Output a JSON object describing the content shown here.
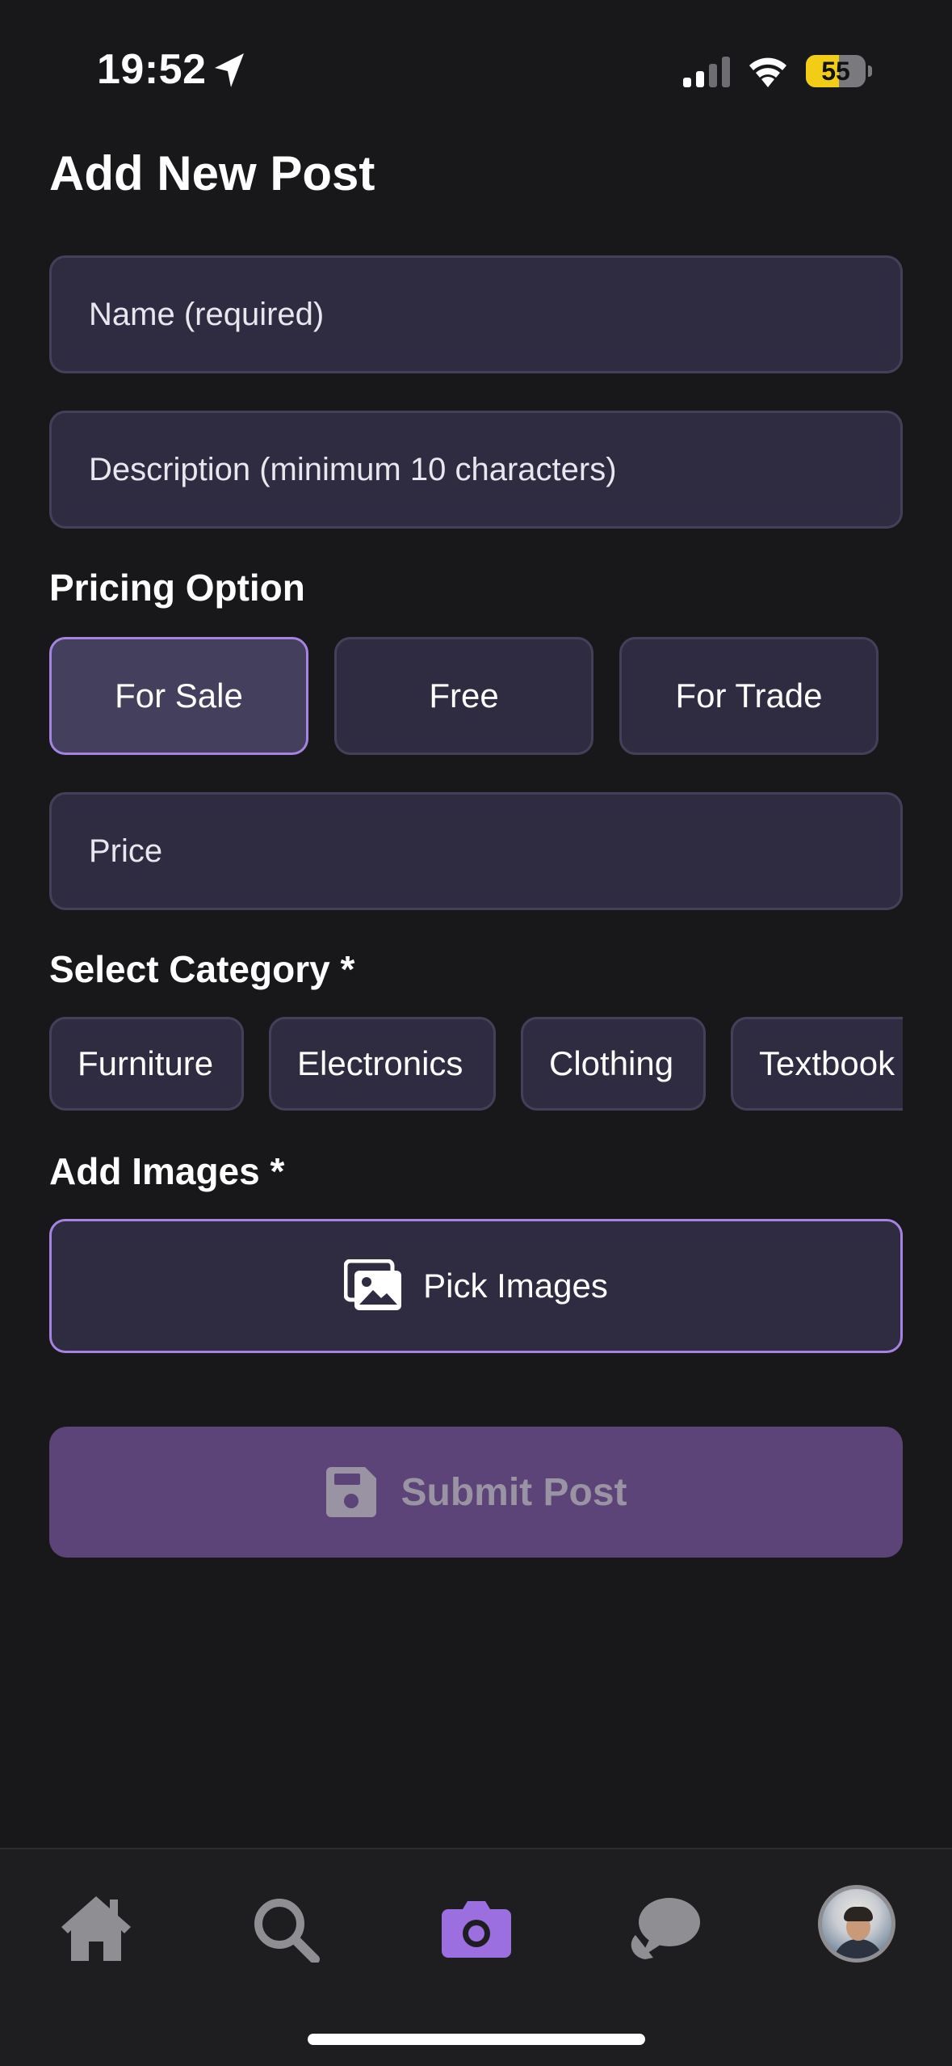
{
  "status_bar": {
    "time": "19:52",
    "battery_level": "55",
    "battery_fraction": 0.55
  },
  "page": {
    "title": "Add New Post"
  },
  "form": {
    "name_placeholder": "Name (required)",
    "description_placeholder": "Description (minimum 10 characters)",
    "pricing_label": "Pricing Option",
    "pricing_options": [
      "For Sale",
      "Free",
      "For Trade"
    ],
    "pricing_selected": "For Sale",
    "price_placeholder": "Price",
    "category_label": "Select Category *",
    "categories": [
      "Furniture",
      "Electronics",
      "Clothing",
      "Textbook"
    ],
    "images_label": "Add Images *",
    "pick_images_label": "Pick Images",
    "submit_label": "Submit Post"
  },
  "tab_bar": {
    "items": [
      "home-icon",
      "search-icon",
      "camera-icon",
      "chat-icon",
      "avatar"
    ],
    "active": "camera-icon"
  },
  "colors": {
    "background": "#18181a",
    "field_bg": "#2f2b40",
    "accent": "#a583e0",
    "submit_bg": "#5c4378",
    "tab_icon": "#8e8e93",
    "tab_active": "#9b6fe0",
    "battery": "#f2cd16"
  }
}
